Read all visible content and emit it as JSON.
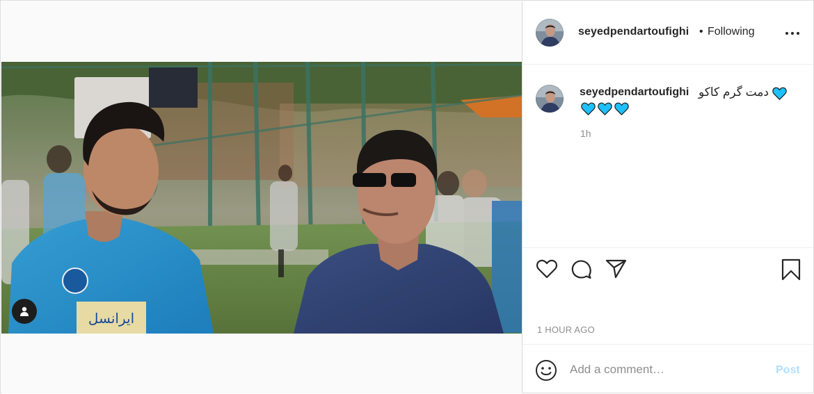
{
  "post": {
    "username": "seyedpendartoufighi",
    "follow_dot": "•",
    "follow_status": "Following",
    "more_icon": "more-options-icon"
  },
  "caption": {
    "username": "seyedpendartoufighi",
    "text": "دمت گرم کاکو",
    "emoji": "💙💙💙💙",
    "emoji_color": "#1ec0ff",
    "relative_time": "1h"
  },
  "actions": {
    "like_icon": "heart-icon",
    "comment_icon": "comment-icon",
    "share_icon": "share-icon",
    "save_icon": "bookmark-icon",
    "timestamp": "1 HOUR AGO"
  },
  "comment_box": {
    "placeholder": "Add a comment…",
    "post_label": "Post",
    "post_color": "#b2dffc"
  },
  "media": {
    "tag_icon": "user-tag-icon",
    "jersey_sponsor": "ایرانسل"
  }
}
